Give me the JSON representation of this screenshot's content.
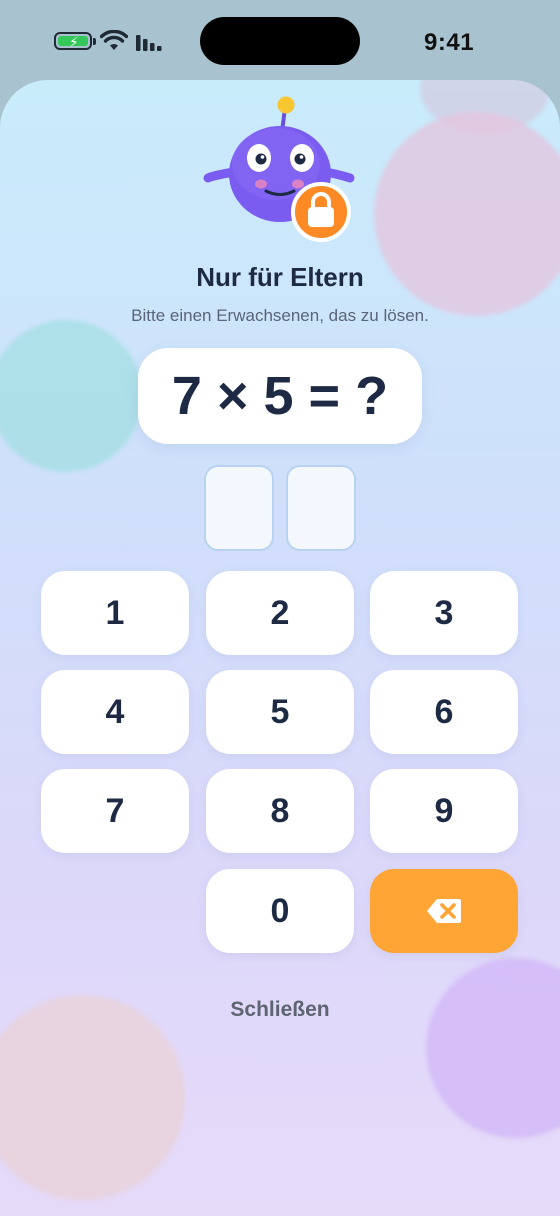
{
  "status_bar": {
    "time": "9:41"
  },
  "header": {
    "title": "Nur für Eltern",
    "subtitle": "Bitte einen Erwachsenen, das zu lösen."
  },
  "puzzle": {
    "equation": "7 × 5 = ?"
  },
  "answer": {
    "digits": [
      "",
      ""
    ]
  },
  "keypad": {
    "keys": [
      "1",
      "2",
      "3",
      "4",
      "5",
      "6",
      "7",
      "8",
      "9",
      "0"
    ],
    "delete_icon": "backspace-icon"
  },
  "footer": {
    "close_label": "Schließen"
  },
  "colors": {
    "accent": "#fea535",
    "text": "#1e2a44",
    "mascot": "#7a5cf0"
  }
}
